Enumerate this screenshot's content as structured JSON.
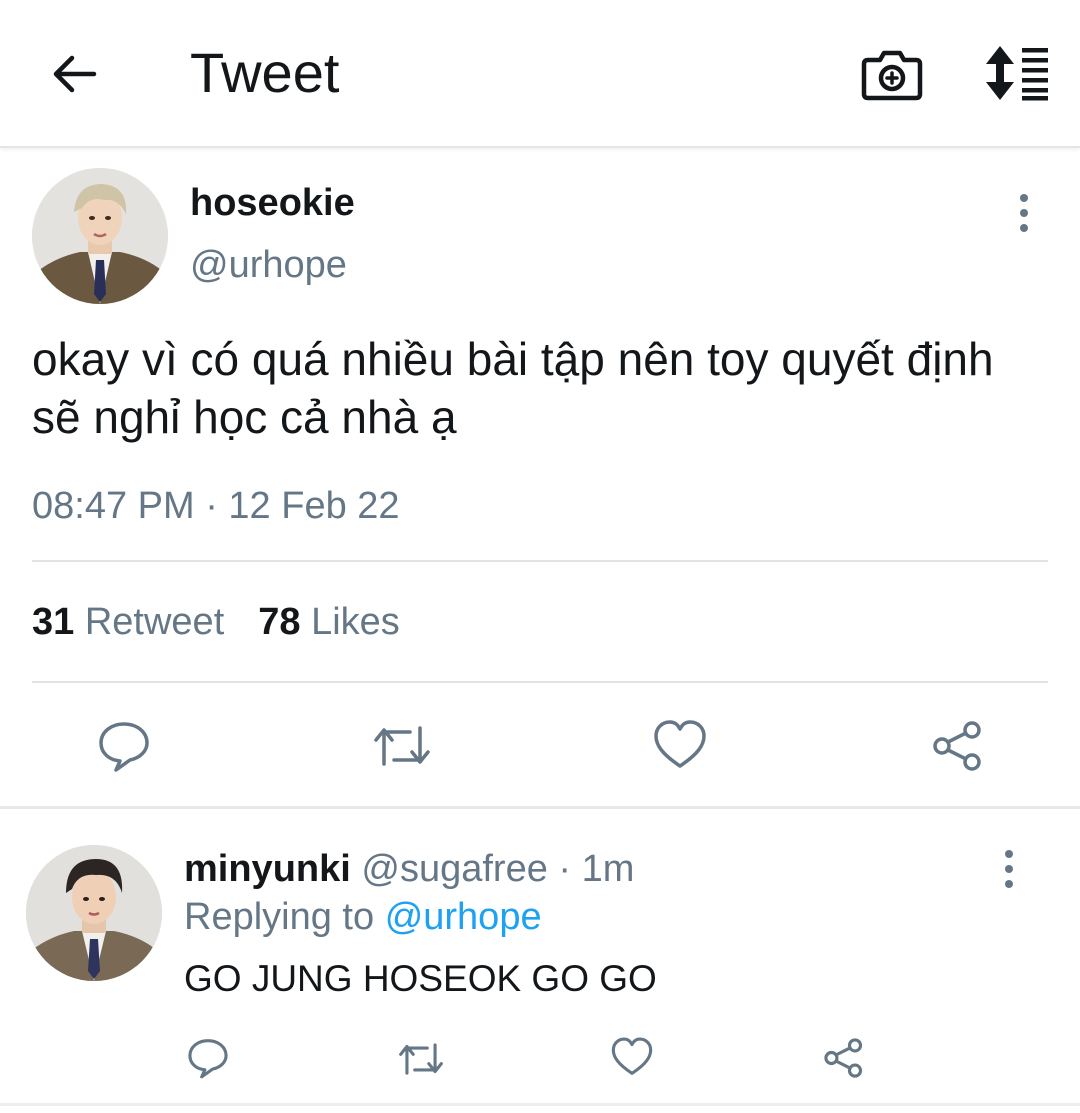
{
  "header": {
    "title": "Tweet",
    "back_icon": "arrow-left-icon",
    "camera_icon": "camera-plus-icon",
    "sort_icon": "sort-list-icon"
  },
  "tweet": {
    "display_name": "hoseokie",
    "handle": "@urhope",
    "text": "okay vì có quá nhiều bài tập nên toy quyết định sẽ nghỉ học cả nhà ạ",
    "timestamp": "08:47 PM · 12 Feb 22",
    "retweet_count": "31",
    "retweet_label": "Retweet",
    "likes_count": "78",
    "likes_label": "Likes"
  },
  "reply": {
    "display_name": "minyunki",
    "handle": "@sugafree",
    "time": "· 1m",
    "replying_prefix": "Replying to",
    "replying_to": "@urhope",
    "text": "GO JUNG HOSEOK GO GO"
  },
  "colors": {
    "text_primary": "#14171a",
    "text_secondary": "#657786",
    "link": "#1da1f2",
    "divider": "#e1e4e7"
  }
}
